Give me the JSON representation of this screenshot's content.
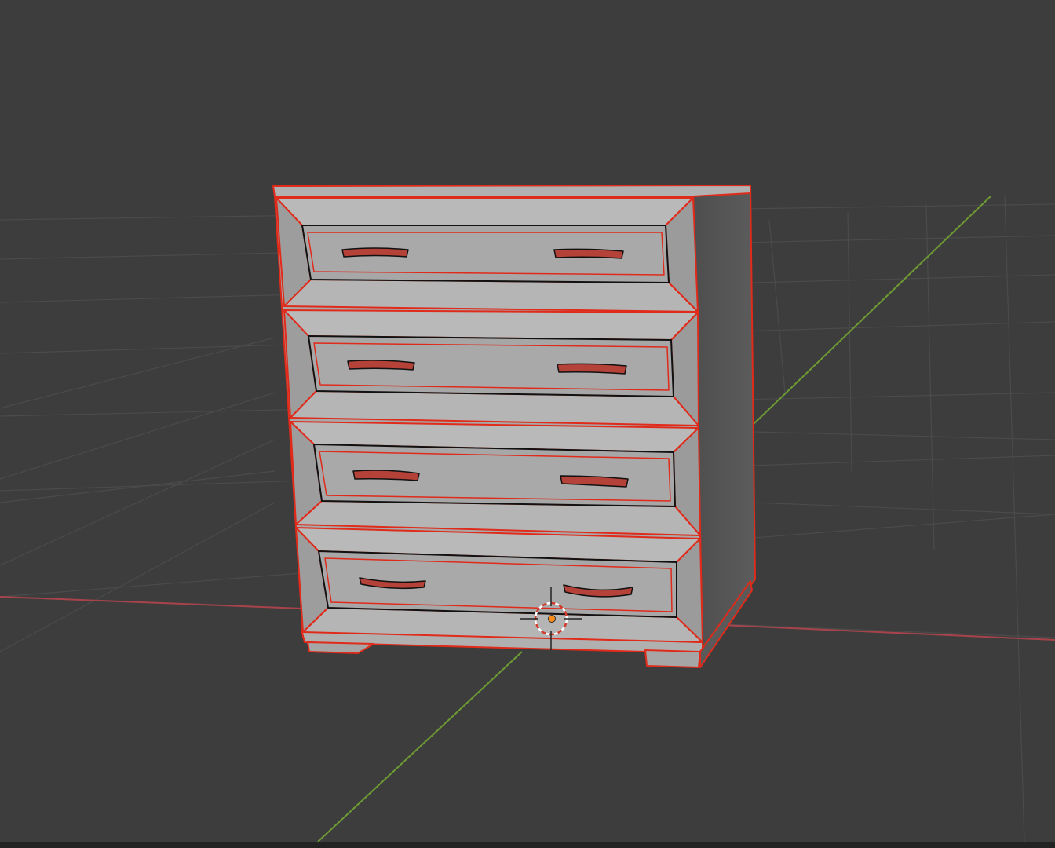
{
  "viewport": {
    "background": "#3d3d3d",
    "grid_color": "#4a4a4a",
    "x_axis_color": "#a8434c",
    "y_axis_color": "#6e9a33",
    "selection_outline_color": "#e02a1a",
    "mesh_fill_color": "#a9a9a9",
    "mesh_side_color": "#555555"
  },
  "scene": {
    "object": "chest-of-drawers",
    "drawer_count": 4,
    "handles_per_drawer": 2,
    "selected": true
  },
  "cursor": {
    "icon": "3d-cursor-icon",
    "origin_icon": "object-origin-icon",
    "origin_color": "#ff8c1a"
  }
}
